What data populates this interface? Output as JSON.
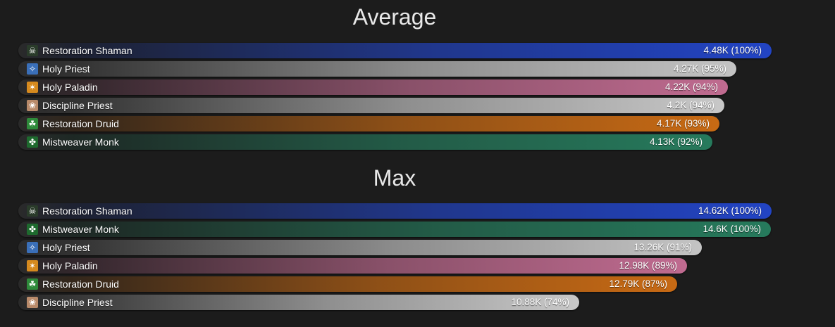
{
  "chart_data": [
    {
      "type": "bar",
      "title": "Average",
      "categories": [
        "Restoration Shaman",
        "Holy Priest",
        "Holy Paladin",
        "Discipline Priest",
        "Restoration Druid",
        "Mistweaver Monk"
      ],
      "values": [
        4480,
        4270,
        4220,
        4200,
        4170,
        4130
      ],
      "percents": [
        100,
        95,
        94,
        94,
        93,
        92
      ],
      "value_labels": [
        "4.48K (100%)",
        "4.27K (95%)",
        "4.22K (94%)",
        "4.2K (94%)",
        "4.17K (93%)",
        "4.13K (92%)"
      ],
      "icons": [
        "shaman-totem-icon",
        "holy-priest-icon",
        "holy-paladin-icon",
        "discipline-priest-icon",
        "druid-leaf-icon",
        "monk-mistweaver-icon"
      ],
      "colors": [
        "#2244c4",
        "#c4c4c4",
        "#c06b90",
        "#c8c8c8",
        "#c86a14",
        "#267a5c"
      ]
    },
    {
      "type": "bar",
      "title": "Max",
      "categories": [
        "Restoration Shaman",
        "Mistweaver Monk",
        "Holy Priest",
        "Holy Paladin",
        "Restoration Druid",
        "Discipline Priest"
      ],
      "values": [
        14620,
        14600,
        13260,
        12980,
        12790,
        10880
      ],
      "percents": [
        100,
        100,
        91,
        89,
        87,
        74
      ],
      "value_labels": [
        "14.62K (100%)",
        "14.6K (100%)",
        "13.26K (91%)",
        "12.98K (89%)",
        "12.79K (87%)",
        "10.88K (74%)"
      ],
      "icons": [
        "shaman-totem-icon",
        "monk-mistweaver-icon",
        "holy-priest-icon",
        "holy-paladin-icon",
        "druid-leaf-icon",
        "discipline-priest-icon"
      ],
      "colors": [
        "#2244c4",
        "#267a5c",
        "#c4c4c4",
        "#c06b90",
        "#c86a14",
        "#c8c8c8"
      ]
    }
  ]
}
